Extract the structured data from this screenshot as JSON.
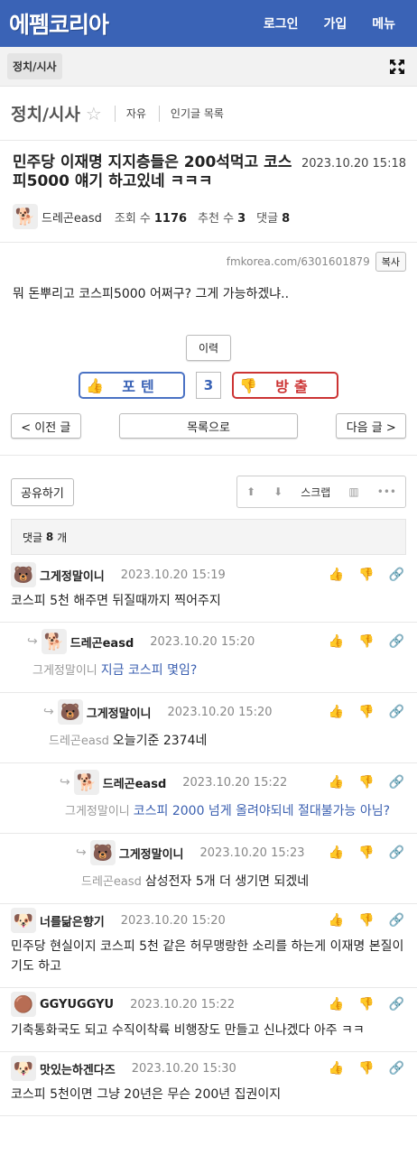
{
  "site": {
    "logo": "에펨코리아",
    "nav": [
      "로그인",
      "가입",
      "메뉴"
    ]
  },
  "subbar": {
    "category": "정치/시사"
  },
  "board": {
    "title": "정치/시사",
    "links": [
      "자유",
      "인기글 목록"
    ]
  },
  "post": {
    "title": "민주당 이재명 지지층들은 200석먹고 코스피5000 얘기 하고있네 ㅋㅋㅋ",
    "date": "2023.10.20 15:18",
    "author": "드레곤easd",
    "views_label": "조회 수",
    "views": "1176",
    "recommend_label": "추천 수",
    "recommend": "3",
    "comments_label": "댓글",
    "comments": "8",
    "url": "fmkorea.com/6301601879",
    "copy_label": "복사",
    "content": "뭐 돈뿌리고 코스피5000 어쩌구?  그게 가능하겠냐.."
  },
  "history_label": "이력",
  "vote": {
    "up_label": "포텐",
    "count": "3",
    "down_label": "방출"
  },
  "nav_buttons": {
    "prev": "< 이전 글",
    "list": "목록으로",
    "next": "다음 글 >"
  },
  "share_label": "공유하기",
  "scrap_label": "스크랩",
  "comment_count": {
    "label": "댓글",
    "count": "8",
    "unit": "개"
  },
  "comments": [
    {
      "name": "그게정말이니",
      "date": "2023.10.20 15:19",
      "reply_to": "",
      "text": "코스피 5천 해주면 뒤질때까지 찍어주지",
      "depth": 0,
      "avatar": "bear",
      "highlight": false
    },
    {
      "name": "드레곤easd",
      "date": "2023.10.20 15:20",
      "reply_to": "그게정말이니",
      "text": "지금 코스피 몇임?",
      "depth": 1,
      "avatar": "dog",
      "highlight": true
    },
    {
      "name": "그게정말이니",
      "date": "2023.10.20 15:20",
      "reply_to": "드레곤easd",
      "text": "오늘기준 2374네",
      "depth": 2,
      "avatar": "bear",
      "highlight": false
    },
    {
      "name": "드레곤easd",
      "date": "2023.10.20 15:22",
      "reply_to": "그게정말이니",
      "text": "코스피 2000 넘게 올려야되네 절대불가능 아님?",
      "depth": 3,
      "avatar": "dog",
      "highlight": true
    },
    {
      "name": "그게정말이니",
      "date": "2023.10.20 15:23",
      "reply_to": "드레곤easd",
      "text": "삼성전자 5개 더 생기면 되겠네",
      "depth": 4,
      "avatar": "bear",
      "highlight": false
    },
    {
      "name": "너를닮은향기",
      "date": "2023.10.20 15:20",
      "reply_to": "",
      "text": "민주당 현실이지 코스피 5천 같은 허무맹랑한 소리를 하는게 이재명 본질이기도 하고",
      "depth": 0,
      "avatar": "puppy",
      "highlight": false
    },
    {
      "name": "GGYUGGYU",
      "date": "2023.10.20 15:22",
      "reply_to": "",
      "text": "기축통화국도 되고 수직이착륙 비행장도 만들고 신나겠다 아주 ㅋㅋ",
      "depth": 0,
      "avatar": "ball",
      "highlight": false
    },
    {
      "name": "맛있는하겐다즈",
      "date": "2023.10.20 15:30",
      "reply_to": "",
      "text": "코스피 5천이면 그냥 20년은 무슨 200년 집권이지",
      "depth": 0,
      "avatar": "puppy2",
      "highlight": false
    }
  ]
}
